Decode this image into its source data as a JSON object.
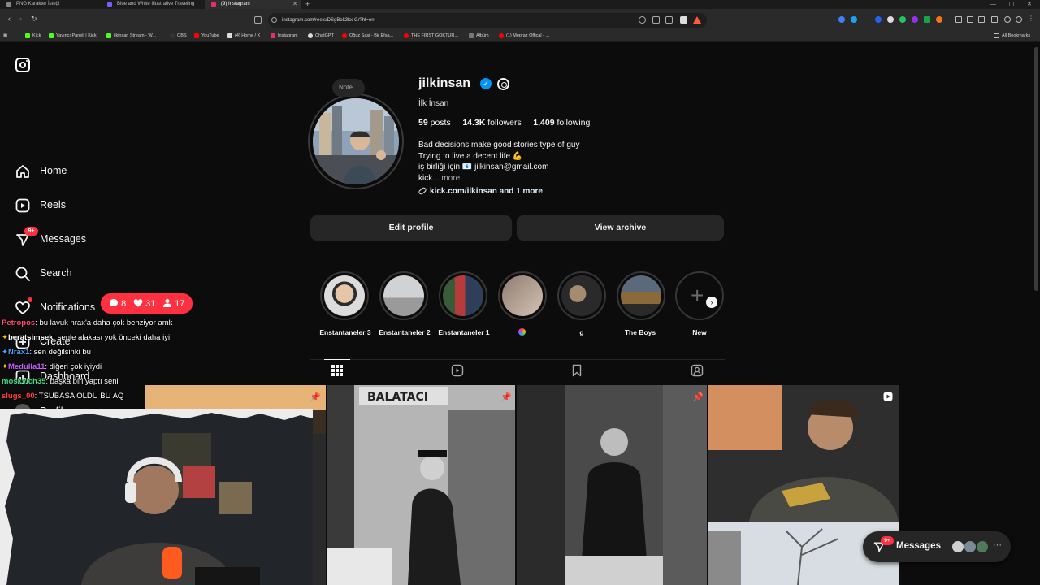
{
  "browser": {
    "tabs": [
      {
        "title": "PNG Karakter İsteği",
        "active": false
      },
      {
        "title": "Blue and White Illustrative Traveling",
        "active": false
      },
      {
        "title": "(9) Instagram",
        "active": true
      }
    ],
    "url": "instagram.com/reels/DSgBok3kx-G/?hl=en",
    "bookmarks": [
      "Kick",
      "Yayıncı Paneli | Kick",
      "ilkinsan Stream - W...",
      "OBS",
      "YouTube",
      "(4) Home / X",
      "Instagram",
      "ChatGPT",
      "Oğuz Sasi - Bir Efsa...",
      "THE FIRST GOKTUR...",
      "Albüm",
      "(1) Mepraz Offical - ..."
    ],
    "all_bookmarks": "All Bookmarks"
  },
  "sidebar": {
    "items": [
      {
        "label": "Home",
        "icon": "home-icon"
      },
      {
        "label": "Reels",
        "icon": "reels-icon"
      },
      {
        "label": "Messages",
        "icon": "messenger-icon",
        "badge": "9+"
      },
      {
        "label": "Search",
        "icon": "search-icon"
      },
      {
        "label": "Notifications",
        "icon": "heart-icon"
      },
      {
        "label": "Create",
        "icon": "plus-icon"
      },
      {
        "label": "Dashboard",
        "icon": "dashboard-icon"
      },
      {
        "label": "Profile",
        "icon": "avatar-icon"
      }
    ],
    "notifications_popup": {
      "comments": "8",
      "likes": "31",
      "follows": "17"
    }
  },
  "profile": {
    "note": "Note...",
    "username": "jilkinsan",
    "full_name": "İlk İnsan",
    "posts": "59",
    "posts_label": "posts",
    "followers": "14.3K",
    "followers_label": "followers",
    "following": "1,409",
    "following_label": "following",
    "bio": [
      "Bad decisions make good stories type of guy",
      "Trying to live a decent life 💪",
      "iş birliği için 📧 jilkinsan@gmail.com",
      "kick..."
    ],
    "more": "more",
    "link": "kick.com/ilkinsan and 1 more",
    "edit_profile": "Edit profile",
    "view_archive": "View archive"
  },
  "highlights": [
    {
      "label": "Enstantaneler 3"
    },
    {
      "label": "Enstantaneler 2"
    },
    {
      "label": "Enstantaneler 1"
    },
    {
      "label": ""
    },
    {
      "label": "g"
    },
    {
      "label": "The Boys"
    },
    {
      "label": "New"
    }
  ],
  "chat": [
    {
      "name": "Petropos",
      "color": "#ff4b6e",
      "text": ": bu lavuk nrax'a daha çok benziyor amk"
    },
    {
      "name": "beratsimsek",
      "color": "#ffffff",
      "text": ": senle alakası yok önceki daha iyi"
    },
    {
      "name": "Nrax1",
      "color": "#4aa3ff",
      "text": ": sen değilsinki bu"
    },
    {
      "name": "Medulla11",
      "color": "#c45bff",
      "text": ": diğeri çok iyiydi"
    },
    {
      "name": "moskvich35",
      "color": "#3ddc84",
      "text": ": başka biri yaptı seni"
    },
    {
      "name": "slugs_00",
      "color": "#ff4040",
      "text": ": TSUBASA OLDU BU AQ"
    }
  ],
  "messages_pill": {
    "label": "Messages",
    "badge": "9+"
  },
  "colors": {
    "accent_red": "#ff3040",
    "verified_blue": "#0095f6",
    "button_bg": "#262626"
  }
}
